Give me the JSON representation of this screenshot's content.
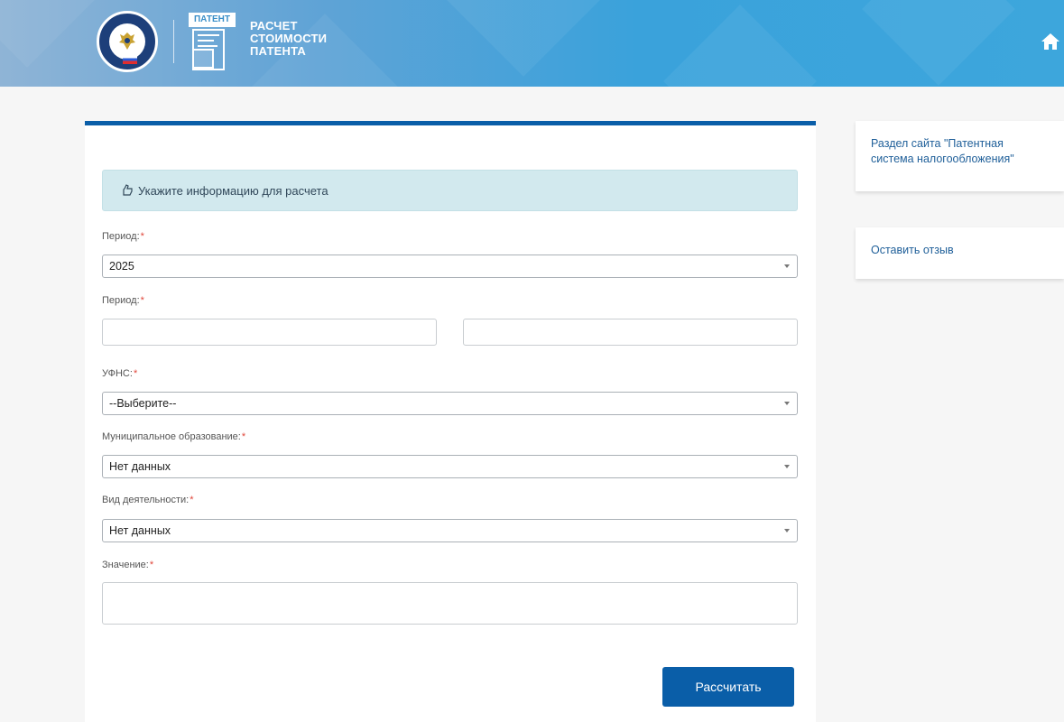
{
  "header": {
    "title_line1": "РАСЧЕТ",
    "title_line2": "СТОИМОСТИ",
    "title_line3": "ПАТЕНТА",
    "patent_badge": "ПАТЕНТ",
    "emblem_icon": "fns-emblem-icon",
    "home_icon": "home-icon"
  },
  "form": {
    "info_text": "Укажите информацию для расчета",
    "info_icon": "hand-point-icon",
    "period_year_label": "Период:",
    "period_year_value": "2025",
    "period_range_label": "Период:",
    "period_from_value": "",
    "period_to_value": "",
    "ufns_label": "УФНС:",
    "ufns_value": "--Выберите--",
    "municipal_label": "Муниципальное образование:",
    "municipal_value": "Нет данных",
    "activity_label": "Вид деятельности:",
    "activity_value": "Нет данных",
    "value_label": "Значение:",
    "value_value": "",
    "required_mark": "*",
    "submit_label": "Рассчитать"
  },
  "sidebar": {
    "link_patent_system": "Раздел сайта \"Патентная система налогообложения\"",
    "link_feedback": "Оставить отзыв"
  },
  "colors": {
    "primary": "#0a5ea8",
    "info_bg": "#d2e9ee",
    "required": "#e0463a",
    "link": "#1f5f99"
  }
}
